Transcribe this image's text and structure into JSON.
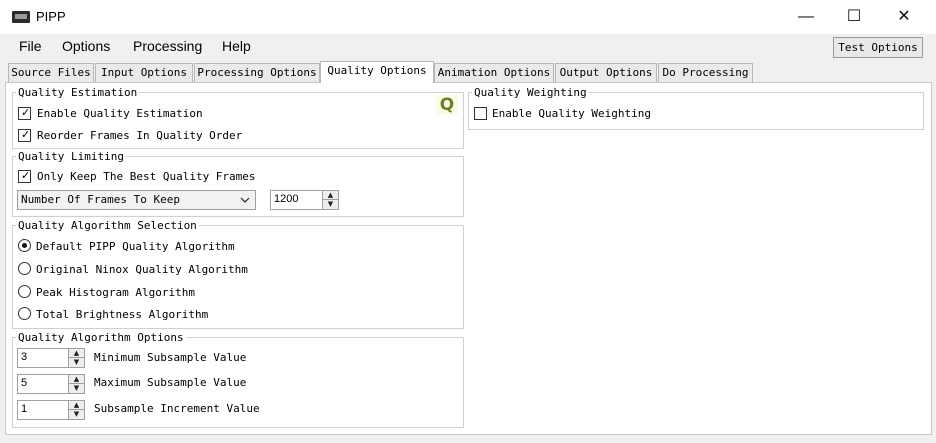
{
  "window": {
    "title": "PIPP",
    "controls": {
      "minimize": "—",
      "maximize": "☐",
      "close": "✕"
    }
  },
  "menu": {
    "items": [
      "File",
      "Options",
      "Processing",
      "Help"
    ],
    "test_options": "Test Options"
  },
  "tabs": [
    {
      "label": "Source Files",
      "active": false
    },
    {
      "label": "Input Options",
      "active": false
    },
    {
      "label": "Processing Options",
      "active": false
    },
    {
      "label": "Quality Options",
      "active": true
    },
    {
      "label": "Animation Options",
      "active": false
    },
    {
      "label": "Output Options",
      "active": false
    },
    {
      "label": "Do Processing",
      "active": false
    }
  ],
  "quality_estimation": {
    "title": "Quality Estimation",
    "badge": "Q",
    "enable": {
      "label": "Enable Quality Estimation",
      "checked": true
    },
    "reorder": {
      "label": "Reorder Frames In Quality Order",
      "checked": true
    }
  },
  "quality_limiting": {
    "title": "Quality Limiting",
    "keep_best": {
      "label": "Only Keep The Best Quality Frames",
      "checked": true
    },
    "mode_select": "Number Of Frames To Keep",
    "frames_value": "1200"
  },
  "algorithm_selection": {
    "title": "Quality Algorithm Selection",
    "options": [
      {
        "label": "Default PIPP Quality Algorithm",
        "selected": true
      },
      {
        "label": "Original Ninox Quality Algorithm",
        "selected": false
      },
      {
        "label": "Peak Histogram Algorithm",
        "selected": false
      },
      {
        "label": "Total Brightness Algorithm",
        "selected": false
      }
    ]
  },
  "algorithm_options": {
    "title": "Quality Algorithm Options",
    "fields": [
      {
        "value": "3",
        "label": "Minimum Subsample Value"
      },
      {
        "value": "5",
        "label": "Maximum Subsample Value"
      },
      {
        "value": "1",
        "label": "Subsample Increment Value"
      }
    ]
  },
  "quality_weighting": {
    "title": "Quality Weighting",
    "enable": {
      "label": "Enable Quality Weighting",
      "checked": false
    }
  },
  "icons": {
    "dropdown": "chevron-down-icon",
    "spin_up": "▲",
    "spin_down": "▼",
    "check": "✓"
  }
}
